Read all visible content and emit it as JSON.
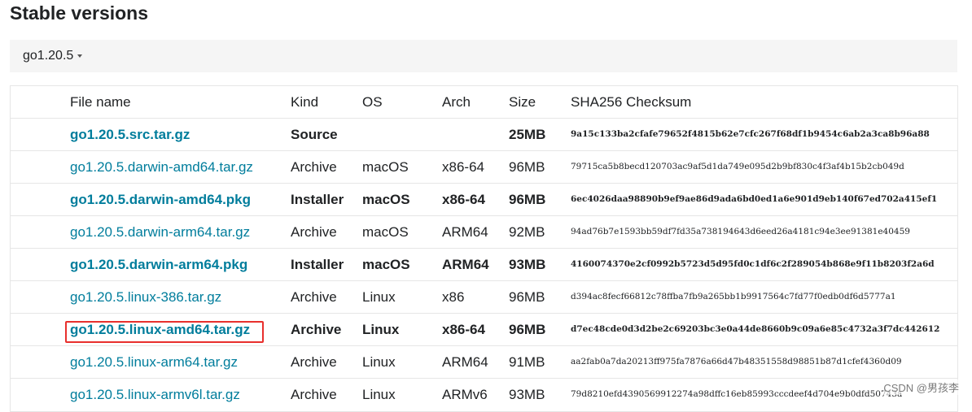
{
  "page": {
    "title": "Stable versions",
    "version_selected": "go1.20.5"
  },
  "table": {
    "headers": {
      "file": "File name",
      "kind": "Kind",
      "os": "OS",
      "arch": "Arch",
      "size": "Size",
      "sha": "SHA256 Checksum"
    },
    "rows": [
      {
        "file": "go1.20.5.src.tar.gz",
        "kind": "Source",
        "os": "",
        "arch": "",
        "size": "25MB",
        "sha": "9a15c133ba2cfafe79652f4815b62e7cfc267f68df1b9454c6ab2a3ca8b96a88",
        "highlight": true
      },
      {
        "file": "go1.20.5.darwin-amd64.tar.gz",
        "kind": "Archive",
        "os": "macOS",
        "arch": "x86-64",
        "size": "96MB",
        "sha": "79715ca5b8becd120703ac9af5d1da749e095d2b9bf830c4f3af4b15b2cb049d",
        "highlight": false
      },
      {
        "file": "go1.20.5.darwin-amd64.pkg",
        "kind": "Installer",
        "os": "macOS",
        "arch": "x86-64",
        "size": "96MB",
        "sha": "6ec4026daa98890b9ef9ae86d9ada6bd0ed1a6e901d9eb140f67ed702a415ef1",
        "highlight": true
      },
      {
        "file": "go1.20.5.darwin-arm64.tar.gz",
        "kind": "Archive",
        "os": "macOS",
        "arch": "ARM64",
        "size": "92MB",
        "sha": "94ad76b7e1593bb59df7fd35a738194643d6eed26a4181c94e3ee91381e40459",
        "highlight": false
      },
      {
        "file": "go1.20.5.darwin-arm64.pkg",
        "kind": "Installer",
        "os": "macOS",
        "arch": "ARM64",
        "size": "93MB",
        "sha": "4160074370e2cf0992b5723d5d95fd0c1df6c2f289054b868e9f11b8203f2a6d",
        "highlight": true
      },
      {
        "file": "go1.20.5.linux-386.tar.gz",
        "kind": "Archive",
        "os": "Linux",
        "arch": "x86",
        "size": "96MB",
        "sha": "d394ac8fecf66812c78ffba7fb9a265bb1b9917564c7fd77f0edb0df6d5777a1",
        "highlight": false
      },
      {
        "file": "go1.20.5.linux-amd64.tar.gz",
        "kind": "Archive",
        "os": "Linux",
        "arch": "x86-64",
        "size": "96MB",
        "sha": "d7ec48cde0d3d2be2c69203bc3e0a44de8660b9c09a6e85c4732a3f7dc442612",
        "highlight": true
      },
      {
        "file": "go1.20.5.linux-arm64.tar.gz",
        "kind": "Archive",
        "os": "Linux",
        "arch": "ARM64",
        "size": "91MB",
        "sha": "aa2fab0a7da20213ff975fa7876a66d47b48351558d98851b87d1cfef4360d09",
        "highlight": false
      },
      {
        "file": "go1.20.5.linux-armv6l.tar.gz",
        "kind": "Archive",
        "os": "Linux",
        "arch": "ARMv6",
        "size": "93MB",
        "sha": "79d8210efd4390569912274a98dffc16eb85993cccdeef4d704e9b0dfd50743a",
        "highlight": false
      }
    ]
  },
  "watermark": "CSDN @男孩李",
  "colors": {
    "link": "#007d9c",
    "highlight_box": "#e8302d",
    "version_bar_bg": "#f5f5f5"
  }
}
